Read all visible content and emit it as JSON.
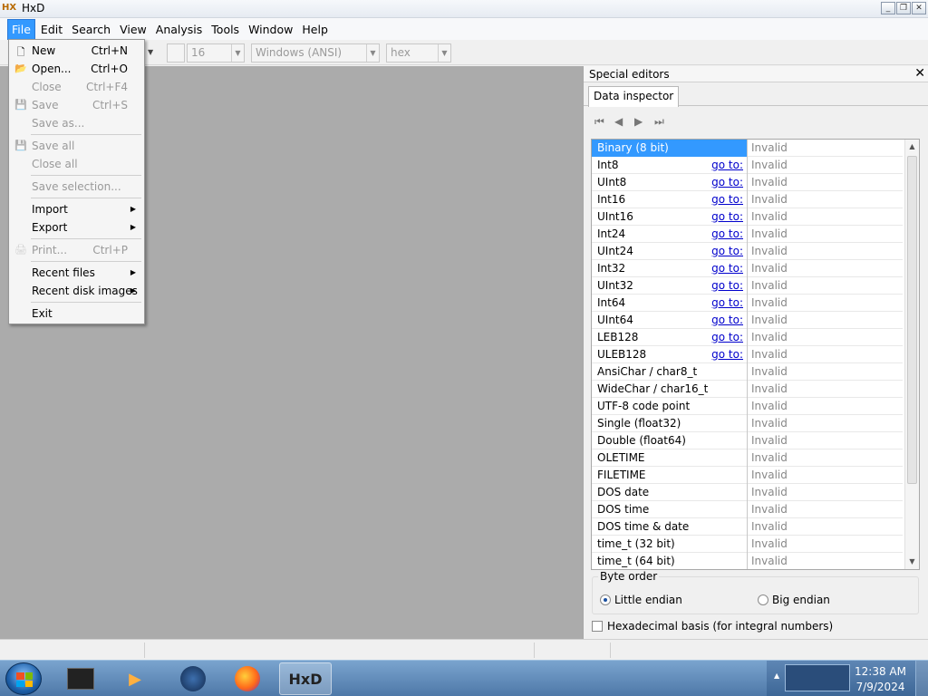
{
  "window": {
    "title": "HxD",
    "app_icon": "hxd-icon",
    "buttons": [
      "minimize-icon",
      "restore-icon",
      "close-icon"
    ]
  },
  "menubar": {
    "items": [
      "File",
      "Edit",
      "Search",
      "View",
      "Analysis",
      "Tools",
      "Window",
      "Help"
    ],
    "active": "File"
  },
  "toolbar": {
    "bytes_per_row": "16",
    "charset": "Windows (ANSI)",
    "offset_base": "hex"
  },
  "file_menu": {
    "items": [
      {
        "label": "New",
        "shortcut": "Ctrl+N",
        "icon": "new-file-icon",
        "disabled": false
      },
      {
        "label": "Open...",
        "shortcut": "Ctrl+O",
        "icon": "open-folder-icon",
        "disabled": false
      },
      {
        "label": "Close",
        "shortcut": "Ctrl+F4",
        "icon": "",
        "disabled": true
      },
      {
        "label": "Save",
        "shortcut": "Ctrl+S",
        "icon": "save-icon",
        "disabled": true
      },
      {
        "label": "Save as...",
        "shortcut": "",
        "icon": "",
        "disabled": true
      },
      {
        "label": "Save all",
        "shortcut": "",
        "icon": "save-all-icon",
        "disabled": true
      },
      {
        "label": "Close all",
        "shortcut": "",
        "icon": "",
        "disabled": true
      },
      {
        "label": "Save selection...",
        "shortcut": "",
        "icon": "",
        "disabled": true
      },
      {
        "label": "Import",
        "shortcut": "",
        "submenu": true,
        "disabled": false
      },
      {
        "label": "Export",
        "shortcut": "",
        "submenu": true,
        "disabled": false
      },
      {
        "label": "Print...",
        "shortcut": "Ctrl+P",
        "icon": "print-icon",
        "disabled": true
      },
      {
        "label": "Recent files",
        "shortcut": "",
        "submenu": true,
        "disabled": false
      },
      {
        "label": "Recent disk images",
        "shortcut": "",
        "submenu": true,
        "disabled": false
      },
      {
        "label": "Exit",
        "shortcut": "",
        "disabled": false
      }
    ]
  },
  "special_editors": {
    "title": "Special editors",
    "tab": "Data inspector",
    "rows": [
      {
        "name": "Binary (8 bit)",
        "goto": "",
        "value": "Invalid"
      },
      {
        "name": "Int8",
        "goto": "go to:",
        "value": "Invalid"
      },
      {
        "name": "UInt8",
        "goto": "go to:",
        "value": "Invalid"
      },
      {
        "name": "Int16",
        "goto": "go to:",
        "value": "Invalid"
      },
      {
        "name": "UInt16",
        "goto": "go to:",
        "value": "Invalid"
      },
      {
        "name": "Int24",
        "goto": "go to:",
        "value": "Invalid"
      },
      {
        "name": "UInt24",
        "goto": "go to:",
        "value": "Invalid"
      },
      {
        "name": "Int32",
        "goto": "go to:",
        "value": "Invalid"
      },
      {
        "name": "UInt32",
        "goto": "go to:",
        "value": "Invalid"
      },
      {
        "name": "Int64",
        "goto": "go to:",
        "value": "Invalid"
      },
      {
        "name": "UInt64",
        "goto": "go to:",
        "value": "Invalid"
      },
      {
        "name": "LEB128",
        "goto": "go to:",
        "value": "Invalid"
      },
      {
        "name": "ULEB128",
        "goto": "go to:",
        "value": "Invalid"
      },
      {
        "name": "AnsiChar / char8_t",
        "goto": "",
        "value": "Invalid"
      },
      {
        "name": "WideChar / char16_t",
        "goto": "",
        "value": "Invalid"
      },
      {
        "name": "UTF-8 code point",
        "goto": "",
        "value": "Invalid"
      },
      {
        "name": "Single (float32)",
        "goto": "",
        "value": "Invalid"
      },
      {
        "name": "Double (float64)",
        "goto": "",
        "value": "Invalid"
      },
      {
        "name": "OLETIME",
        "goto": "",
        "value": "Invalid"
      },
      {
        "name": "FILETIME",
        "goto": "",
        "value": "Invalid"
      },
      {
        "name": "DOS date",
        "goto": "",
        "value": "Invalid"
      },
      {
        "name": "DOS time",
        "goto": "",
        "value": "Invalid"
      },
      {
        "name": "DOS time & date",
        "goto": "",
        "value": "Invalid"
      },
      {
        "name": "time_t (32 bit)",
        "goto": "",
        "value": "Invalid"
      },
      {
        "name": "time_t (64 bit)",
        "goto": "",
        "value": "Invalid"
      }
    ],
    "byte_order": {
      "legend": "Byte order",
      "little": "Little endian",
      "big": "Big endian",
      "selected": "Little endian"
    },
    "hex_basis": "Hexadecimal basis (for integral numbers)"
  },
  "taskbar": {
    "apps": [
      "terminal-icon",
      "media-player-icon",
      "thunderbird-icon",
      "firefox-icon",
      "hxd-icon"
    ],
    "clock": {
      "time": "12:38 AM",
      "date": "7/9/2024"
    }
  },
  "colors": {
    "accent": "#3399ff",
    "workspace": "#ababab",
    "link": "#0000cc"
  }
}
